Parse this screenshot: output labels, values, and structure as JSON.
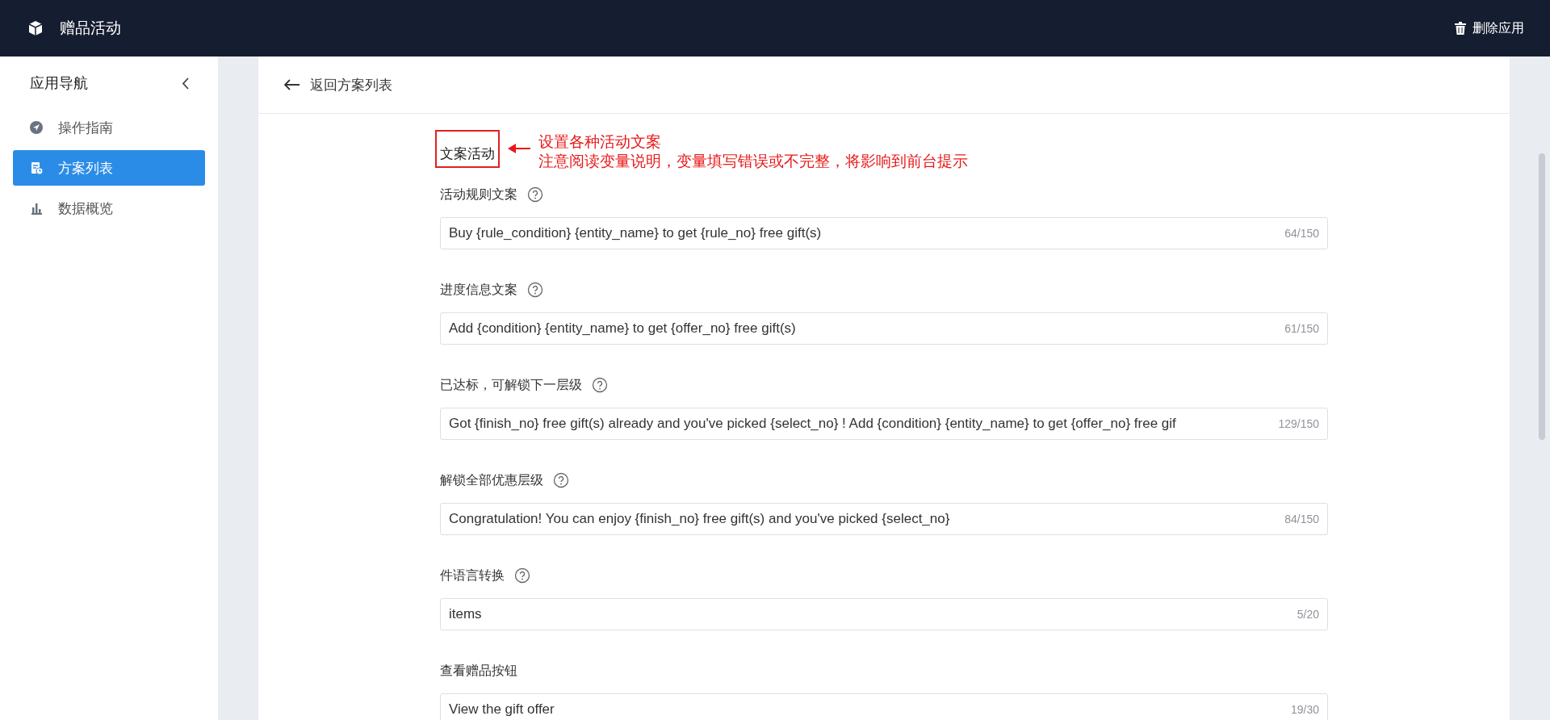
{
  "header": {
    "title": "赠品活动",
    "action": "删除应用"
  },
  "sidebar": {
    "title": "应用导航",
    "items": [
      {
        "label": "操作指南",
        "selected": false
      },
      {
        "label": "方案列表",
        "selected": true
      },
      {
        "label": "数据概览",
        "selected": false
      }
    ]
  },
  "back_link": "返回方案列表",
  "section": {
    "title": "文案活动",
    "annotation": [
      "设置各种活动文案",
      "注意阅读变量说明，变量填写错误或不完整，将影响到前台提示"
    ]
  },
  "fields": [
    {
      "label": "活动规则文案",
      "help": true,
      "value": "Buy {rule_condition} {entity_name} to get {rule_no} free gift(s)",
      "count": "64/150"
    },
    {
      "label": "进度信息文案",
      "help": true,
      "value": "Add {condition} {entity_name}  to get {offer_no} free gift(s)",
      "count": "61/150"
    },
    {
      "label": "已达标，可解锁下一层级",
      "help": true,
      "value": "Got {finish_no} free gift(s) already and you've picked {select_no} ! Add {condition} {entity_name} to get {offer_no} free gif",
      "count": "129/150"
    },
    {
      "label": "解锁全部优惠层级",
      "help": true,
      "value": "Congratulation! You can enjoy {finish_no} free gift(s) and you've picked {select_no}",
      "count": "84/150"
    },
    {
      "label": "件语言转换",
      "help": true,
      "value": "items",
      "count": "5/20"
    },
    {
      "label": "查看赠品按钮",
      "help": false,
      "value": "View the gift offer",
      "count": "19/30"
    }
  ]
}
